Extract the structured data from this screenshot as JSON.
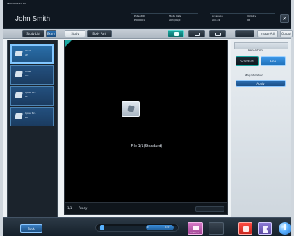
{
  "header": {
    "app_small_title": "INFOSUITE ES 11",
    "patient_name": "John Smith",
    "top_right_button": "×",
    "fields": [
      {
        "label": "Patient ID",
        "value": "P-000001"
      },
      {
        "label": "Study Date",
        "value": "2024/01/01"
      },
      {
        "label": "Accession",
        "value": "ACC-01"
      },
      {
        "label": "Modality",
        "value": "DR"
      }
    ]
  },
  "toolbar": {
    "left_tabs": [
      "Study List",
      "Exam"
    ],
    "mid_tabs": [
      "Study",
      "Body Part"
    ],
    "layout_buttons": [
      "1",
      "2",
      "3"
    ],
    "right_buttons": [
      "",
      "Image Adj",
      "Output"
    ]
  },
  "thumbnails": [
    {
      "title": "Chest",
      "sub": "AP"
    },
    {
      "title": "Chest",
      "sub": "LAT"
    },
    {
      "title": "Upper Ext.",
      "sub": "AP"
    },
    {
      "title": "Upper Ext.",
      "sub": "LAT"
    }
  ],
  "viewer": {
    "center_caption": "File 1/1(Standard)",
    "corner_label": "",
    "footer_left": "1/1",
    "footer_text": "Ready"
  },
  "right_panel": {
    "section_title": "Resolution",
    "toggle_left": "Standard",
    "toggle_right": "Fine",
    "section2_title": "Magnification",
    "apply_button": "Apply"
  },
  "bottom": {
    "left_button": "Back",
    "slider_left": "0",
    "slider_right": "100",
    "btn_1": "Settings",
    "btn_2": "",
    "btn_3": "",
    "btn_4": "",
    "btn_5": ""
  },
  "colors": {
    "accent_teal": "#1aa7a1",
    "accent_blue": "#2d86d6",
    "danger": "#ff3b30"
  }
}
